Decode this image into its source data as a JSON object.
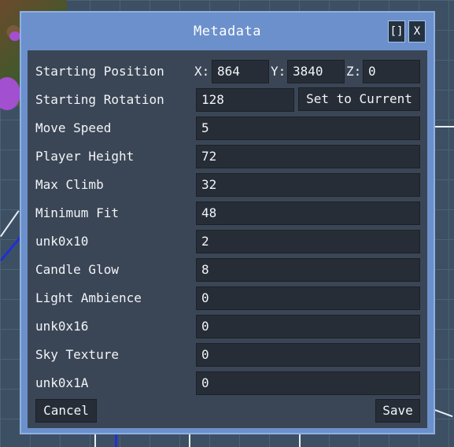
{
  "window": {
    "title": "Metadata",
    "maximize_label": "[]",
    "close_label": "X"
  },
  "position": {
    "label": "Starting Position",
    "x_label": "X:",
    "x": "864",
    "y_label": "Y:",
    "y": "3840",
    "z_label": "Z:",
    "z": "0"
  },
  "rotation": {
    "label": "Starting Rotation",
    "value": "128",
    "button": "Set to Current"
  },
  "fields": [
    {
      "label": "Move Speed",
      "value": "5"
    },
    {
      "label": "Player Height",
      "value": "72"
    },
    {
      "label": "Max Climb",
      "value": "32"
    },
    {
      "label": "Minimum Fit",
      "value": "48"
    },
    {
      "label": "unk0x10",
      "value": "2"
    },
    {
      "label": "Candle Glow",
      "value": "8"
    },
    {
      "label": "Light Ambience",
      "value": "0"
    },
    {
      "label": "unk0x16",
      "value": "0"
    },
    {
      "label": "Sky Texture",
      "value": "0"
    },
    {
      "label": "unk0x1A",
      "value": "0"
    }
  ],
  "footer": {
    "cancel": "Cancel",
    "save": "Save"
  },
  "colors": {
    "window": "#6b90cc",
    "panel": "#3a4656",
    "field": "#262d37"
  }
}
